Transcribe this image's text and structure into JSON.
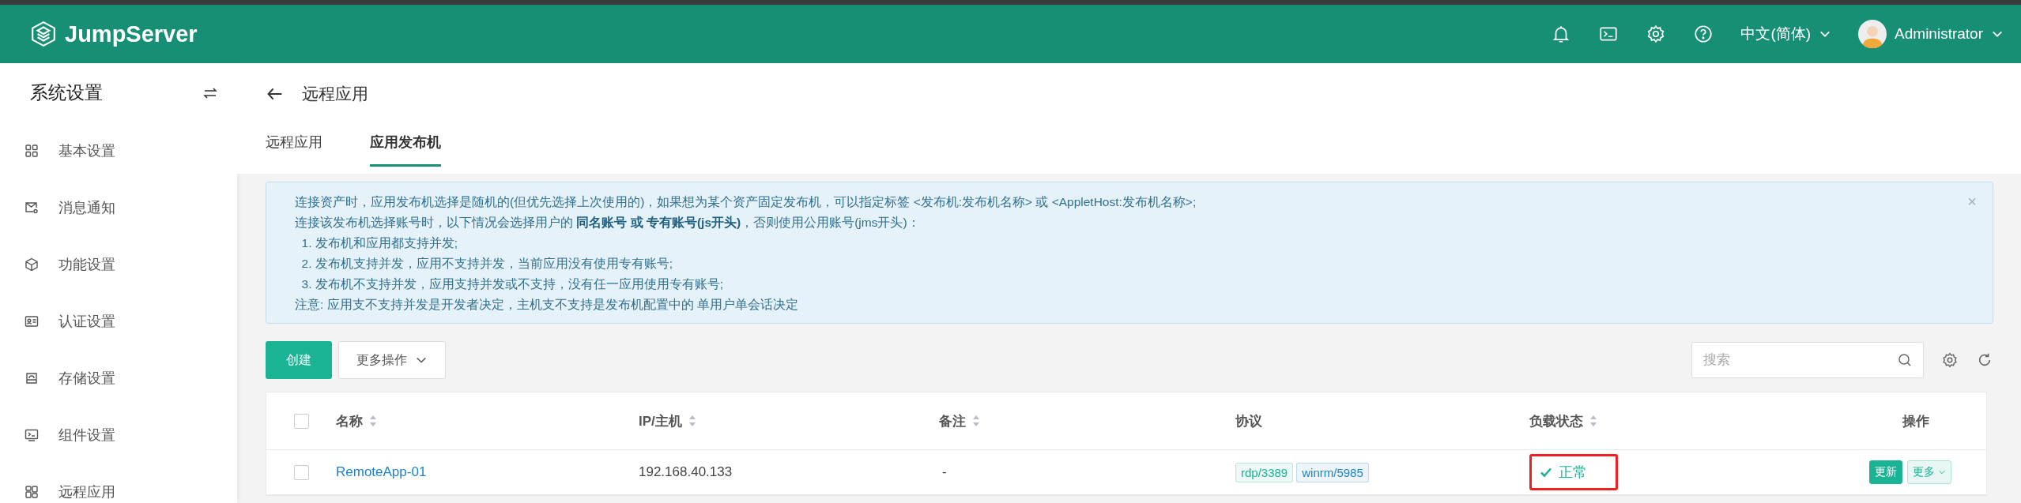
{
  "header": {
    "logo": "JumpServer",
    "language": "中文(简体)",
    "user": "Administrator"
  },
  "sidebar": {
    "title": "系统设置",
    "items": [
      {
        "label": "基本设置",
        "kind": "grid"
      },
      {
        "label": "消息通知",
        "kind": "mail"
      },
      {
        "label": "功能设置",
        "kind": "cube"
      },
      {
        "label": "认证设置",
        "kind": "card"
      },
      {
        "label": "存储设置",
        "kind": "storage"
      },
      {
        "label": "组件设置",
        "kind": "terminal"
      },
      {
        "label": "远程应用",
        "kind": "apps"
      }
    ]
  },
  "page": {
    "title": "远程应用",
    "tabs": [
      {
        "label": "远程应用",
        "selected": false
      },
      {
        "label": "应用发布机",
        "selected": true
      }
    ]
  },
  "notice": {
    "close": "×",
    "lines": [
      "连接资产时，应用发布机选择是随机的(但优先选择上次使用的)，如果想为某个资产固定发布机，可以指定标签 <发布机:发布机名称> 或 <AppletHost:发布机名称>;",
      "连接该发布机选择账号时，以下情况会选择用户的 **同名账号 或 专有账号(js开头)**，否则使用公用账号(jms开头)：",
      "  1. 发布机和应用都支持并发;",
      "  2. 发布机支持并发，应用不支持并发，当前应用没有使用专有账号;",
      "  3. 发布机不支持并发，应用支持并发或不支持，没有任一应用使用专有账号;",
      "注意: 应用支不支持并发是开发者决定，主机支不支持是发布机配置中的 单用户单会话决定"
    ]
  },
  "toolbar": {
    "create": "创建",
    "more": "更多操作",
    "search": {
      "placeholder": "搜索"
    }
  },
  "table": {
    "all_checked": false,
    "columns": [
      {
        "label": "名称",
        "sortable": true
      },
      {
        "label": "IP/主机",
        "sortable": true
      },
      {
        "label": "备注",
        "sortable": true
      },
      {
        "label": "协议",
        "sortable": false
      },
      {
        "label": "负载状态",
        "sortable": true
      },
      {
        "label": "操作",
        "sortable": false
      }
    ],
    "rows": [
      {
        "checked": false,
        "name": "RemoteApp-01",
        "ip": "192.168.40.133",
        "comment": "-",
        "protocols": [
          {
            "label": "rdp/3389",
            "color": "#1ab394"
          },
          {
            "label": "winrm/5985",
            "color": "#1c84c6"
          }
        ],
        "status": "正常",
        "highlighted": true,
        "actions": [
          "更新",
          "更多"
        ]
      }
    ]
  }
}
